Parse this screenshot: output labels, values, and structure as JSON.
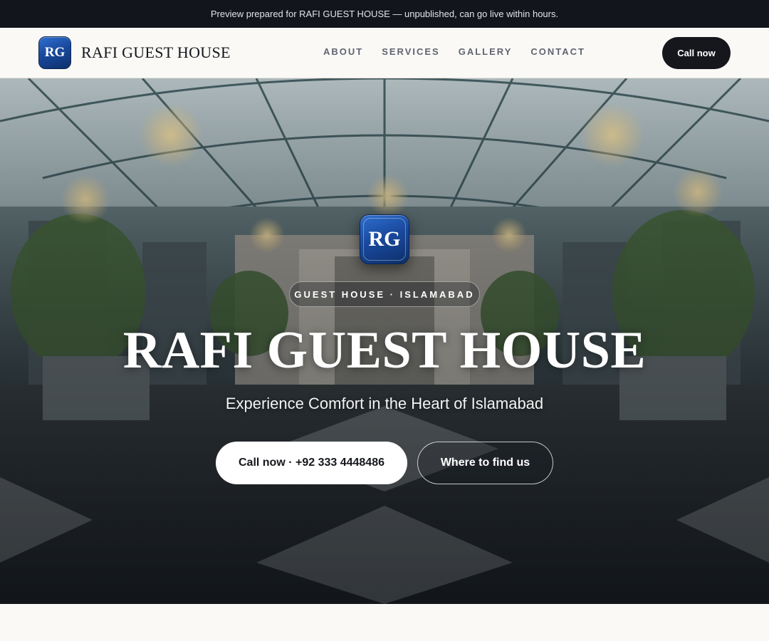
{
  "banner": {
    "text": "Preview prepared for RAFI GUEST HOUSE — unpublished, can go live within hours."
  },
  "header": {
    "logo_initials": "RG",
    "brand_name": "RAFI GUEST HOUSE",
    "nav": [
      {
        "label": "ABOUT"
      },
      {
        "label": "SERVICES"
      },
      {
        "label": "GALLERY"
      },
      {
        "label": "CONTACT"
      }
    ],
    "cta_label": "Call now"
  },
  "hero": {
    "badge_initials": "RG",
    "eyebrow": "GUEST HOUSE · ISLAMABAD",
    "title": "RAFI GUEST HOUSE",
    "subtitle": "Experience Comfort in the Heart of Islamabad",
    "primary_button": "Call now · +92 333 4448486",
    "secondary_button": "Where to find us"
  },
  "colors": {
    "banner_bg": "#12151b",
    "brand_blue": "#1a4a9e",
    "dark": "#15171c",
    "page_bg": "#faf9f6"
  }
}
